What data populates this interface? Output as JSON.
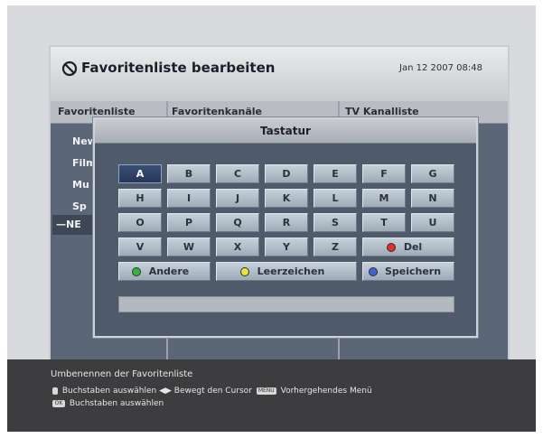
{
  "window": {
    "title": "Favoritenliste bearbeiten",
    "datetime": "Jan 12 2007 08:48",
    "columns": [
      "Favoritenliste",
      "Favoritenkanäle",
      "TV Kanalliste"
    ],
    "list_items": [
      "New",
      "Film",
      "Mu",
      "Sp",
      "—NE"
    ]
  },
  "keyboard": {
    "title": "Tastatur",
    "rows": [
      [
        "A",
        "B",
        "C",
        "D",
        "E",
        "F",
        "G"
      ],
      [
        "H",
        "I",
        "J",
        "K",
        "L",
        "M",
        "N"
      ],
      [
        "O",
        "P",
        "Q",
        "R",
        "S",
        "T",
        "U"
      ],
      [
        "V",
        "W",
        "X",
        "Y",
        "Z"
      ]
    ],
    "active_key": "A",
    "del_label": "Del",
    "other_label": "Andere",
    "space_label": "Leerzeichen",
    "save_label": "Speichern",
    "input_value": ""
  },
  "help": {
    "title": "Umbenennen der Favoritenliste",
    "line1_a": "Buchstaben auswählen",
    "line1_b": "Bewegt den Cursor",
    "line1_c": "Vorhergehendes Menü",
    "line2": "Buchstaben auswählen",
    "menu_tag": "MENU",
    "ok_tag": "OK"
  },
  "colors": {
    "red": "#e0302a",
    "green": "#31b83a",
    "yellow": "#e8e23a",
    "blue": "#3f62d6"
  }
}
